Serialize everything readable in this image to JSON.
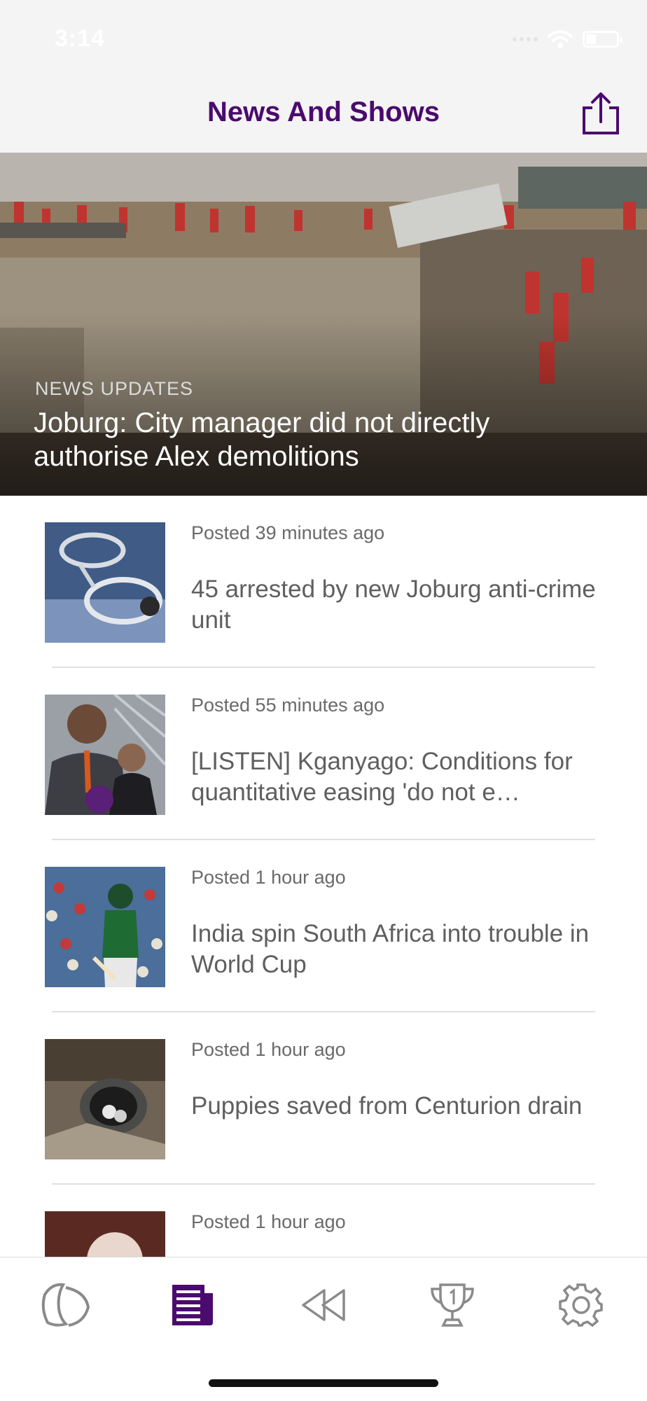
{
  "status_bar": {
    "time": "3:14"
  },
  "nav": {
    "title": "News And Shows",
    "share_icon": "share-icon"
  },
  "hero": {
    "category": "NEWS UPDATES",
    "headline": "Joburg: City manager did not directly authorise Alex demolitions"
  },
  "articles": [
    {
      "posted": "Posted 39 minutes ago",
      "headline": "45 arrested by new Joburg anti-crime unit",
      "thumb": "handcuffs-photo"
    },
    {
      "posted": "Posted 55 minutes ago",
      "headline": "[LISTEN] Kganyago: Conditions for quantitative easing 'do not e…",
      "thumb": "press-conference-photo"
    },
    {
      "posted": "Posted 1 hour ago",
      "headline": "India spin South Africa into trouble in World Cup",
      "thumb": "cricket-player-photo"
    },
    {
      "posted": "Posted 1 hour ago",
      "headline": "Puppies saved from Centurion drain",
      "thumb": "drain-puppies-photo"
    },
    {
      "posted": "Posted 1 hour ago",
      "headline": "",
      "thumb": "person-photo"
    }
  ],
  "tabs": [
    {
      "name": "tab-listen",
      "icon": "headphone-logo-icon",
      "active": false
    },
    {
      "name": "tab-news",
      "icon": "newspaper-icon",
      "active": true
    },
    {
      "name": "tab-rewind",
      "icon": "rewind-icon",
      "active": false
    },
    {
      "name": "tab-competitions",
      "icon": "trophy-icon",
      "active": false
    },
    {
      "name": "tab-settings",
      "icon": "gear-icon",
      "active": false
    }
  ],
  "colors": {
    "accent": "#4b0a6e",
    "inactive_icon": "#8a8a8a",
    "headline_text": "#5f5f5f"
  }
}
